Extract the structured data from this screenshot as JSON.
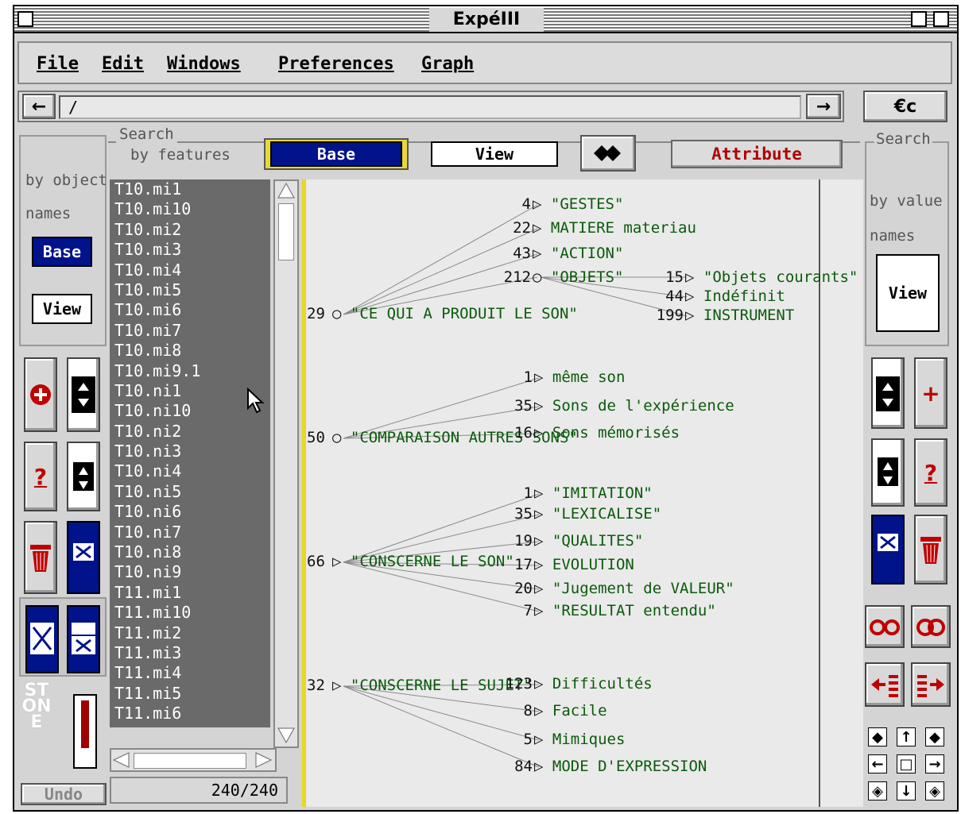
{
  "window": {
    "title": "ExpéIII"
  },
  "menubar": [
    {
      "label": "File"
    },
    {
      "label": "Edit"
    },
    {
      "label": "Windows"
    },
    {
      "label": "Preferences"
    },
    {
      "label": "Graph"
    }
  ],
  "pathbar": {
    "path": "/",
    "back_glyph": "←",
    "forward_glyph": "→",
    "special_glyph": "€c"
  },
  "left_panel": {
    "line1": "by object",
    "line2": "names",
    "base_label": "Base",
    "view_label": "View"
  },
  "search_features": {
    "title": "Search",
    "subtitle": "by features",
    "base_label": "Base",
    "view_label": "View",
    "attribute_label": "Attribute"
  },
  "right_panel": {
    "title": "Search",
    "line1": "by value",
    "line2": "names",
    "view_label": "View"
  },
  "object_list": [
    "T10.mi1",
    "T10.mi10",
    "T10.mi2",
    "T10.mi3",
    "T10.mi4",
    "T10.mi5",
    "T10.mi6",
    "T10.mi7",
    "T10.mi8",
    "T10.mi9.1",
    "T10.ni1",
    "T10.ni10",
    "T10.ni2",
    "T10.ni3",
    "T10.ni4",
    "T10.ni5",
    "T10.ni6",
    "T10.ni7",
    "T10.ni8",
    "T10.ni9",
    "T11.mi1",
    "T11.mi10",
    "T11.mi2",
    "T11.mi3",
    "T11.mi4",
    "T11.mi5",
    "T11.mi6"
  ],
  "counter": "240/240",
  "undo_label": "Undo",
  "stone_label": "STONE",
  "graph": {
    "roots": [
      {
        "count": "29",
        "label": "\"CE QUI A PRODUIT LE SON\""
      },
      {
        "count": "50",
        "label": "\"COMPARAISON AUTRES SONS\""
      },
      {
        "count": "66",
        "label": "\"CONSCERNE LE SON\""
      },
      {
        "count": "32",
        "label": "\"CONSCERNE LE SUJET\""
      }
    ],
    "nodes": [
      {
        "count": "4",
        "label": "\"GESTES\""
      },
      {
        "count": "22",
        "label": "MATIERE materiau"
      },
      {
        "count": "43",
        "label": "\"ACTION\""
      },
      {
        "count": "212",
        "label": "\"OBJETS\""
      },
      {
        "count": "15",
        "label": "\"Objets courants\""
      },
      {
        "count": "44",
        "label": "Indéfinit"
      },
      {
        "count": "199",
        "label": "INSTRUMENT"
      },
      {
        "count": "1",
        "label": "même son"
      },
      {
        "count": "35",
        "label": "Sons de l'expérience"
      },
      {
        "count": "16",
        "label": "Sons mémorisés"
      },
      {
        "count": "1",
        "label": "\"IMITATION\""
      },
      {
        "count": "35",
        "label": "\"LEXICALISE\""
      },
      {
        "count": "19",
        "label": "\"QUALITES\""
      },
      {
        "count": "17",
        "label": "EVOLUTION"
      },
      {
        "count": "20",
        "label": "\"Jugement de VALEUR\""
      },
      {
        "count": "7",
        "label": "\"RESULTAT entendu\""
      },
      {
        "count": "123",
        "label": "Difficultés"
      },
      {
        "count": "8",
        "label": "Facile"
      },
      {
        "count": "5",
        "label": "Mimiques"
      },
      {
        "count": "84",
        "label": "MODE D'EXPRESSION"
      }
    ]
  },
  "tool_glyphs": {
    "help": "?",
    "add": "+"
  },
  "colors": {
    "base_blue": "#00138a",
    "red_accent": "#c00000",
    "list_bg": "#6a6a6a",
    "separator": "#e8d820",
    "node_text": "#0b5a0b"
  }
}
